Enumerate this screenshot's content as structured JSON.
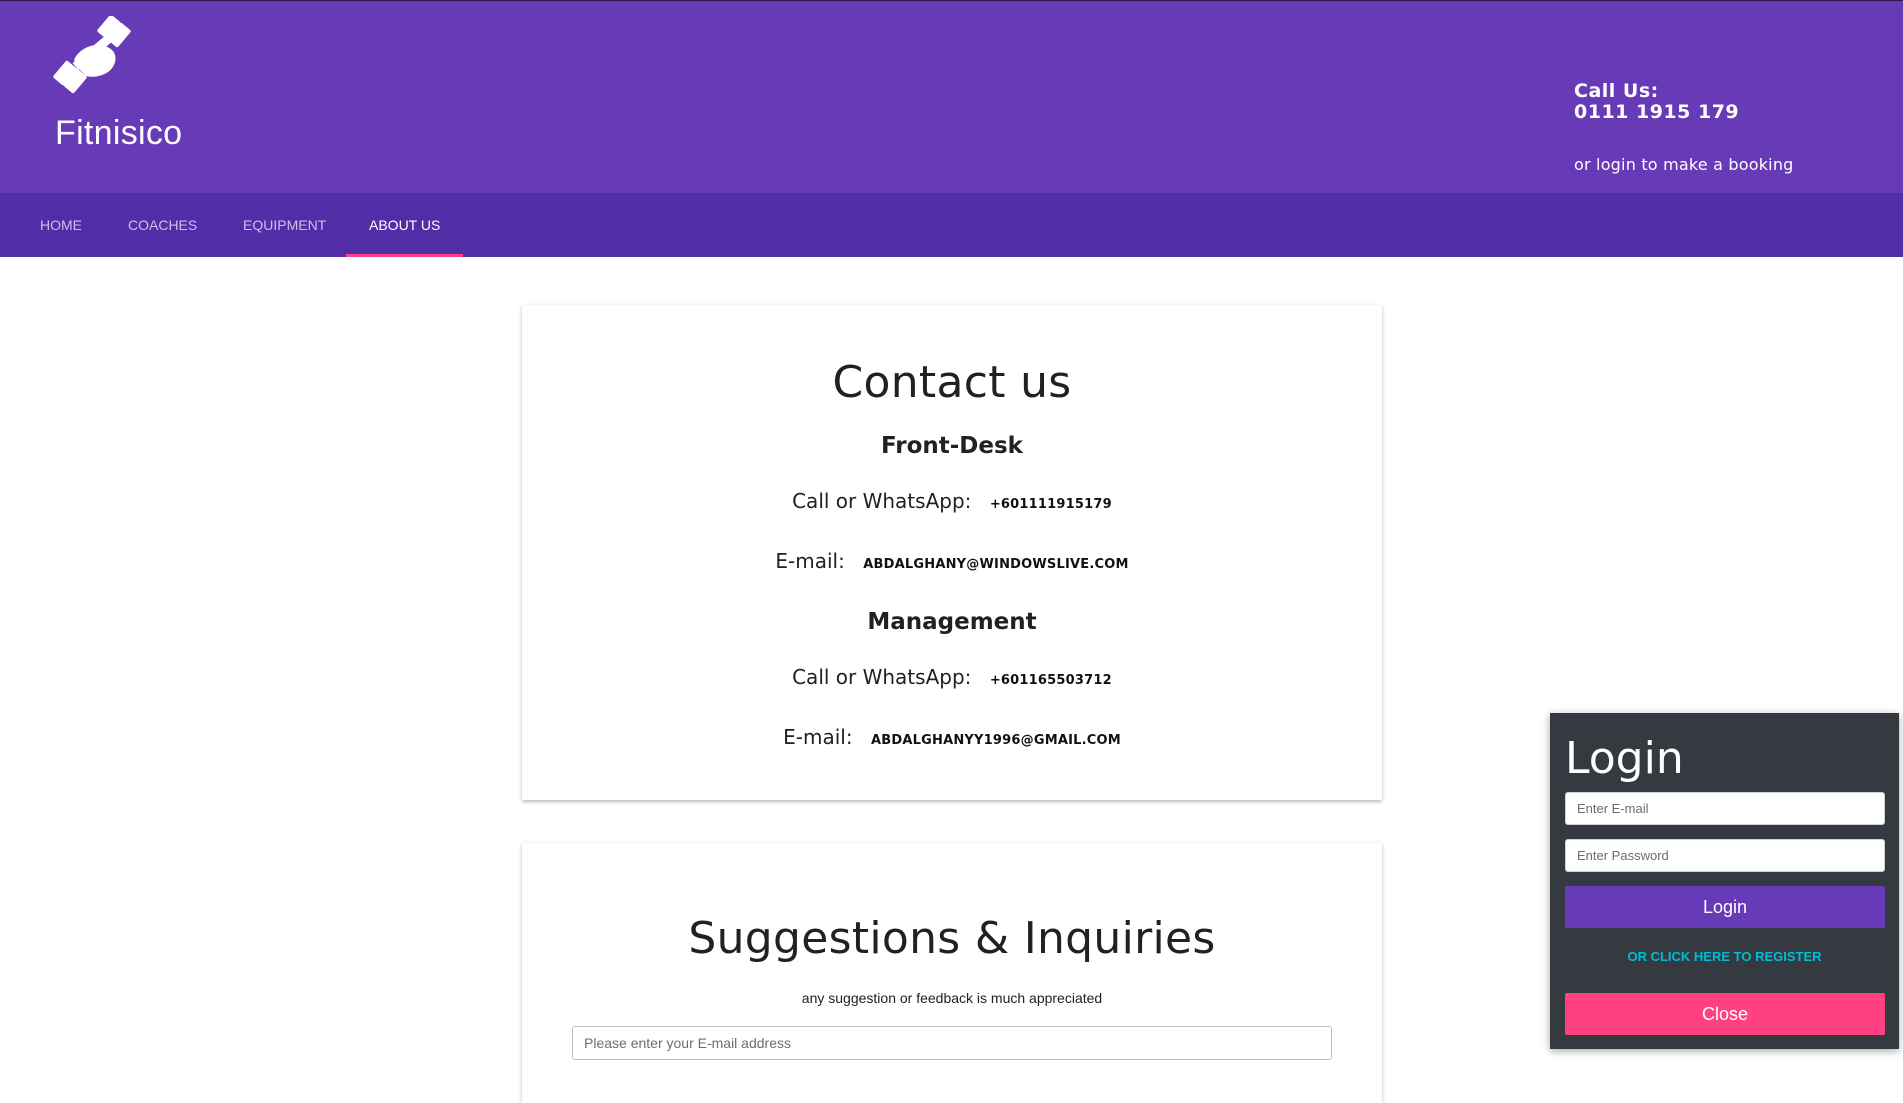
{
  "header": {
    "brand": "Fitnisico",
    "logo_icon": "dumbbell-icon",
    "call_label": "Call Us:",
    "call_number": "0111 1915 179",
    "call_note": "or login to make a booking"
  },
  "nav": {
    "items": [
      {
        "label": "HOME"
      },
      {
        "label": "COACHES"
      },
      {
        "label": "EQUIPMENT"
      },
      {
        "label": "ABOUT US"
      }
    ],
    "active": "ABOUT US"
  },
  "contact": {
    "title": "Contact us",
    "sections": [
      {
        "heading": "Front-Desk",
        "phone_label": "Call or WhatsApp:",
        "phone": "+601111915179",
        "email_label": "E-mail:",
        "email": "ABDALGHANY@WINDOWSLIVE.COM"
      },
      {
        "heading": "Management",
        "phone_label": "Call or WhatsApp:",
        "phone": "+601165503712",
        "email_label": "E-mail:",
        "email": "ABDALGHANYY1996@GMAIL.COM"
      }
    ]
  },
  "suggestions": {
    "title": "Suggestions & Inquiries",
    "note": "any suggestion or feedback is much appreciated",
    "email_placeholder": "Please enter your E-mail address"
  },
  "login": {
    "title": "Login",
    "email_placeholder": "Enter E-mail",
    "password_placeholder": "Enter Password",
    "login_button": "Login",
    "register_link": "OR CLICK HERE TO REGISTER",
    "close_button": "Close"
  },
  "colors": {
    "header_bg": "#673ab7",
    "nav_bg": "#512da8",
    "accent_pink": "#ff4081",
    "link_cyan": "#00bcd4",
    "login_panel_bg": "#343a40"
  }
}
